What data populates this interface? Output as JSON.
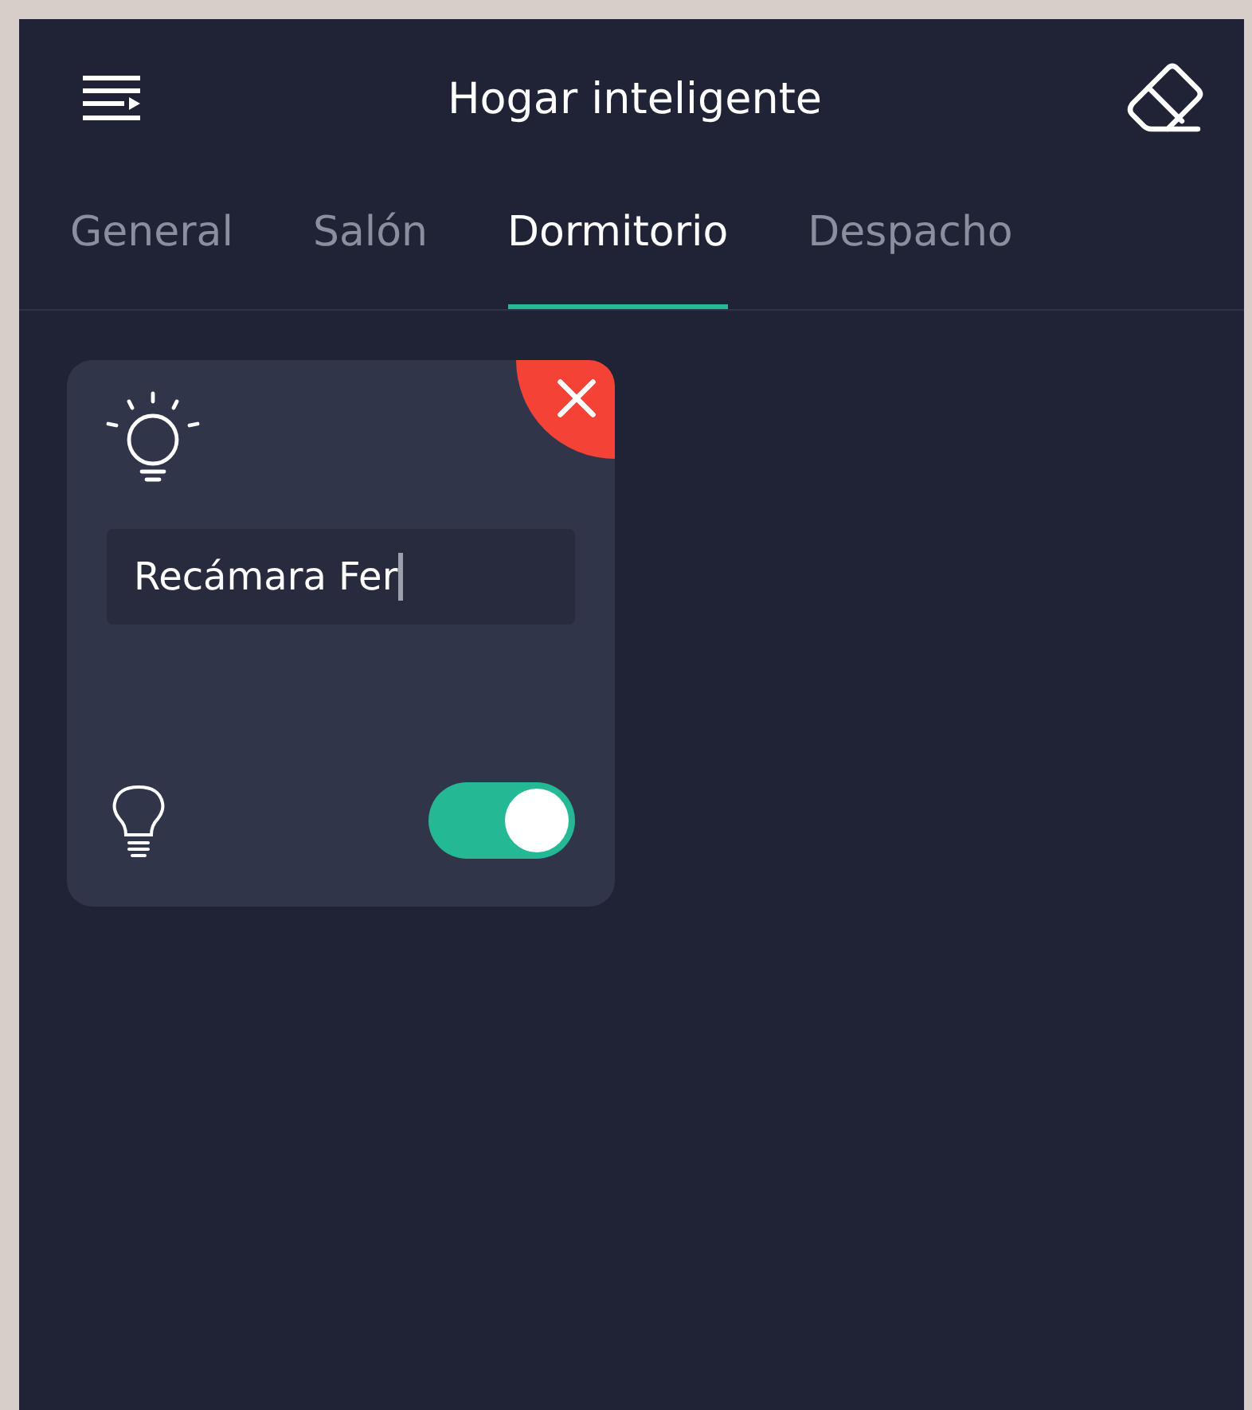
{
  "header": {
    "title": "Hogar inteligente"
  },
  "tabs": [
    {
      "label": "General",
      "selected": false
    },
    {
      "label": "Salón",
      "selected": false
    },
    {
      "label": "Dormitorio",
      "selected": true
    },
    {
      "label": "Despacho",
      "selected": false
    }
  ],
  "devices": [
    {
      "name": "Recámara Fer",
      "on": true
    }
  ]
}
